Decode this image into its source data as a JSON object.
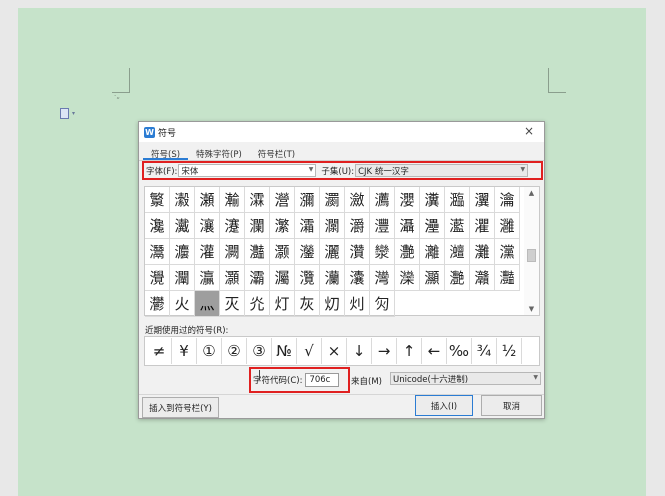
{
  "doc": {
    "para_mark": "·„",
    "widget_arrow": "▾"
  },
  "dialog": {
    "title": "符号",
    "app_icon": "W",
    "close": "×",
    "tabs": [
      "符号(S)",
      "特殊字符(P)",
      "符号栏(T)"
    ],
    "font_label": "字体(F):",
    "font_value": "宋体",
    "subset_label": "子集(U):",
    "subset_value": "CJK 统一汉字",
    "grid": [
      [
        "瀪",
        "瀫",
        "瀬",
        "瀭",
        "瀮",
        "瀯",
        "瀰",
        "瀱",
        "瀲",
        "瀳",
        "瀴",
        "瀵",
        "瀶",
        "瀷"
      ],
      [
        "瀹",
        "瀺",
        "瀻",
        "瀼",
        "瀽",
        "瀾",
        "瀿",
        "灀",
        "灁",
        "灂",
        "灃",
        "灄",
        "灅",
        "灆"
      ],
      [
        "灈",
        "灉",
        "灊",
        "灋",
        "灌",
        "灍",
        "灎",
        "灏",
        "灐",
        "灑",
        "灒",
        "灓",
        "灔",
        "灕"
      ],
      [
        "灗",
        "灘",
        "灙",
        "灚",
        "灛",
        "灜",
        "灝",
        "灞",
        "灟",
        "灠",
        "灡",
        "灢",
        "灣",
        "灤"
      ],
      [
        "灦",
        "灧",
        "灨",
        "灩",
        "灪",
        "火",
        "灬",
        "灭",
        "灮",
        "灯",
        "灰",
        "灱",
        "灲",
        "灳"
      ]
    ],
    "selected_char": "灬",
    "recent_label": "近期使用过的符号(R):",
    "recent": [
      "≠",
      "¥",
      "①",
      "②",
      "③",
      "№",
      "√",
      "×",
      "↓",
      "→",
      "↑",
      "←",
      "‰",
      "¾",
      "½"
    ],
    "code_label": "字符代码(C):",
    "code_value": "706c",
    "from_label": "来自(M)",
    "from_value": "Unicode(十六进制)",
    "btn_insert_bar": "插入到符号栏(Y)",
    "btn_insert": "插入(I)",
    "btn_cancel": "取消"
  }
}
